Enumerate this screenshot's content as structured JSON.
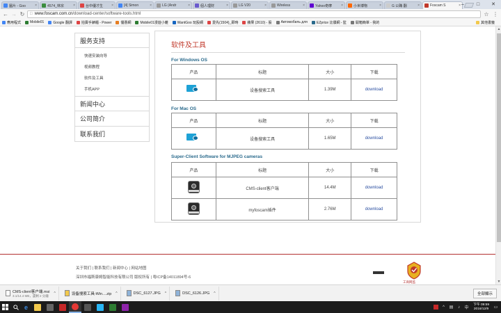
{
  "browser": {
    "tabs": [
      {
        "label": "圖片 - Goo",
        "color": "#4285f4"
      },
      {
        "label": "4574_林宗",
        "color": "#3b8d3e"
      },
      {
        "label": "台中優才生",
        "color": "#d44"
      },
      {
        "label": "[4] Simon",
        "color": "#4285f4"
      },
      {
        "label": "LG (Andr",
        "color": "#999"
      },
      {
        "label": "個人理財",
        "color": "#6a5acd"
      },
      {
        "label": "LG V20",
        "color": "#999"
      },
      {
        "label": "Wireless",
        "color": "#999"
      },
      {
        "label": "Yahoo奇摩",
        "color": "#5f01d1"
      },
      {
        "label": "小米博物",
        "color": "#ff6700"
      },
      {
        "label": "G 公職 翻",
        "color": "#ccc"
      },
      {
        "label": "Foscam S",
        "color": "#c0392b"
      }
    ],
    "url_host": "www.foscam.com.cn",
    "url_path": "/download-center/software-tools.html",
    "bookmarks": [
      {
        "label": "應用程式",
        "color": "#4285f4"
      },
      {
        "label": "Mobile01",
        "color": "#2e7d32"
      },
      {
        "label": "Google 翻譯",
        "color": "#4285f4"
      },
      {
        "label": "拍賣手錶櫃 - Power",
        "color": "#d44"
      },
      {
        "label": "優惠網",
        "color": "#e67e22"
      },
      {
        "label": "Mobile01漫遊小雜",
        "color": "#2e7d32"
      },
      {
        "label": "WantGoo 玩股網",
        "color": "#1565c0"
      },
      {
        "label": "愛先(1504)_即時",
        "color": "#d44"
      },
      {
        "label": "蘋果 (2610) - 股",
        "color": "#d44"
      },
      {
        "label": "Автомобиль для",
        "color": "#777"
      },
      {
        "label": "EZprice 比價網 - 監",
        "color": "#2a6a8c"
      },
      {
        "label": "開箱簡單 - 我的",
        "color": "#777"
      }
    ],
    "bookmarks_other": "其他書籤"
  },
  "sidebar": {
    "heading": "服务支持",
    "subitems": [
      "快速安装向导",
      "视频教程",
      "软件及工具",
      "手机APP"
    ],
    "items": [
      "新闻中心",
      "公司简介",
      "联系我们"
    ]
  },
  "main": {
    "title": "软件及工具",
    "table_headers": {
      "product": "产品",
      "title": "标题",
      "size": "大小",
      "download": "下载"
    },
    "sections": [
      {
        "heading": "For Windows OS",
        "rows": [
          {
            "icon": "search-tool-icon",
            "title": "设备搜索工具",
            "size": "1.39M",
            "download": "download"
          }
        ]
      },
      {
        "heading": "For Mac OS",
        "rows": [
          {
            "icon": "search-tool-icon",
            "title": "设备搜索工具",
            "size": "1.65M",
            "download": "download"
          }
        ]
      },
      {
        "heading": "Super-Client Software for MJPEG cameras",
        "rows": [
          {
            "icon": "camera-client-icon",
            "title": "CMS-client客户端",
            "size": "14.4M",
            "download": "download"
          },
          {
            "icon": "camera-client-icon",
            "title": "myfoscam插件",
            "size": "2.76M",
            "download": "download"
          }
        ]
      }
    ]
  },
  "footer": {
    "links": "关于我们 | 联系我们 | 新闻中心 | 网站地图",
    "copyright": "深圳市福斯康姆智能科技有限公司 版权所有 | 粤ICP备14011894号-6",
    "seal_text": "工商网监"
  },
  "downloads": [
    {
      "name": "CMS-client客户端.msi",
      "sub": "3.1/14.4 MB，還剩 2 分鐘"
    },
    {
      "name": "设备搜索工具-Win....zip",
      "sub": ""
    },
    {
      "name": "DSC_6127.JPG",
      "sub": ""
    },
    {
      "name": "DSC_6126.JPG",
      "sub": ""
    }
  ],
  "downloads_show_all": "全部顯示",
  "taskbar": {
    "apps": [
      {
        "name": "file-explorer",
        "color": "#f2c94c"
      },
      {
        "name": "calculator",
        "color": "#666"
      },
      {
        "name": "app-red",
        "color": "#c62828"
      },
      {
        "name": "chrome",
        "color": "#e53935"
      },
      {
        "name": "app-tools",
        "color": "#555"
      },
      {
        "name": "app-s",
        "color": "#29b6f6"
      },
      {
        "name": "app-tray",
        "color": "#2e7d32"
      },
      {
        "name": "app-p",
        "color": "#8e24aa"
      }
    ],
    "time": "下午 09:59",
    "date": "2016/12/9"
  }
}
